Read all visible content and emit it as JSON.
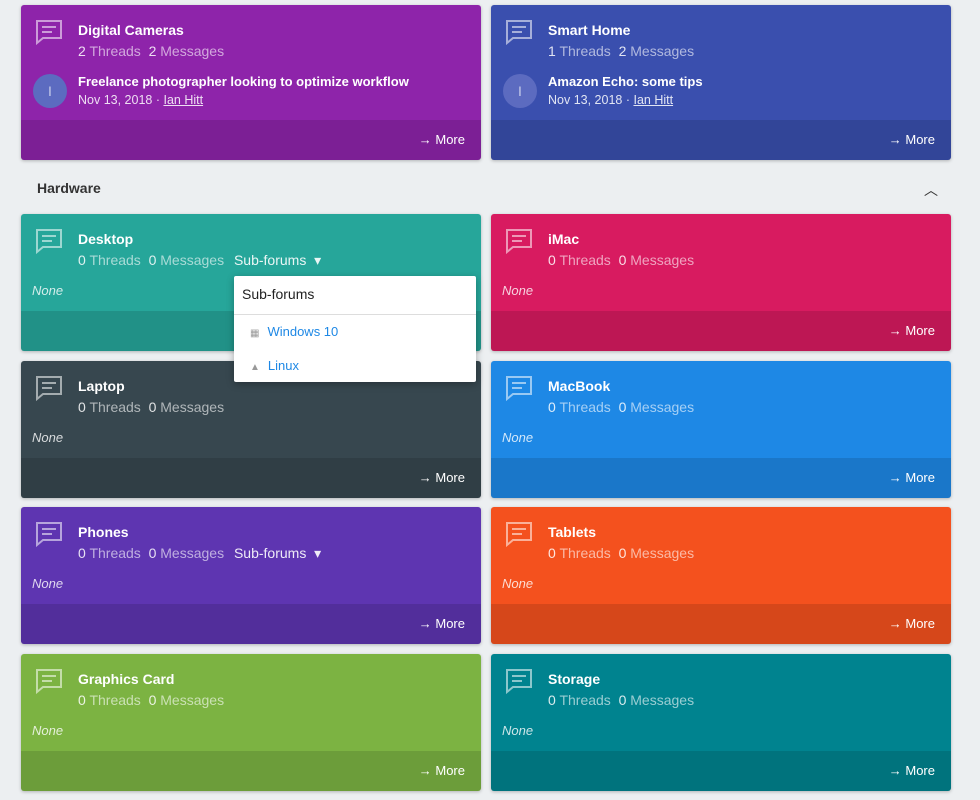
{
  "section": {
    "title": "Hardware",
    "collapse_icon": "chevron-up-icon"
  },
  "more_label": "More",
  "none_label": "None",
  "threads_label": "Threads",
  "messages_label": "Messages",
  "subforums_label": "Sub-forums",
  "top_cards": [
    {
      "title": "Digital Cameras",
      "threads": "2",
      "messages": "2",
      "color": "#8e24aa",
      "avatar": "I",
      "post": "Freelance photographer looking to optimize workflow",
      "date": "Nov 13, 2018",
      "author": "Ian Hitt"
    },
    {
      "title": "Smart Home",
      "threads": "1",
      "messages": "2",
      "color": "#3a4fae",
      "avatar": "I",
      "post": "Amazon Echo: some tips",
      "date": "Nov 13, 2018",
      "author": "Ian Hitt"
    }
  ],
  "cards": [
    {
      "title": "Desktop",
      "threads": "0",
      "messages": "0",
      "color": "#26a69a",
      "subforums": true
    },
    {
      "title": "iMac",
      "threads": "0",
      "messages": "0",
      "color": "#d81b60"
    },
    {
      "title": "Laptop",
      "threads": "0",
      "messages": "0",
      "color": "#37474f"
    },
    {
      "title": "MacBook",
      "threads": "0",
      "messages": "0",
      "color": "#1e88e5"
    },
    {
      "title": "Phones",
      "threads": "0",
      "messages": "0",
      "color": "#5e35b1",
      "subforums": true
    },
    {
      "title": "Tablets",
      "threads": "0",
      "messages": "0",
      "color": "#f4511e"
    },
    {
      "title": "Graphics Card",
      "threads": "0",
      "messages": "0",
      "color": "#7cb342"
    },
    {
      "title": "Storage",
      "threads": "0",
      "messages": "0",
      "color": "#00838f"
    }
  ],
  "subforum_menu": {
    "title": "Sub-forums",
    "items": [
      {
        "label": "Windows 10",
        "icon": "windows-icon"
      },
      {
        "label": "Linux",
        "icon": "linux-icon"
      }
    ]
  }
}
